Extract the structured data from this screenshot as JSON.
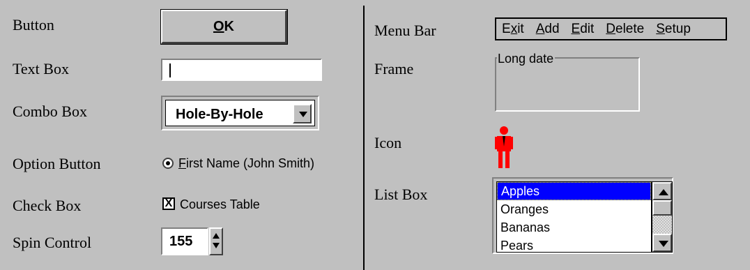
{
  "labels": {
    "button": "Button",
    "text_box": "Text Box",
    "combo_box": "Combo Box",
    "option_button": "Option Button",
    "check_box": "Check Box",
    "spin_control": "Spin Control",
    "menu_bar": "Menu Bar",
    "frame": "Frame",
    "icon": "Icon",
    "list_box": "List Box"
  },
  "ok_button": {
    "mnemonic": "O",
    "rest": "K"
  },
  "text_box": {
    "value": ""
  },
  "combo_box": {
    "value": "Hole-By-Hole"
  },
  "option_button": {
    "mnemonic": "F",
    "rest": "irst Name (John Smith)",
    "selected": true
  },
  "check_box": {
    "mark": "X",
    "label": "Courses Table",
    "checked": true
  },
  "spin_control": {
    "value": "155"
  },
  "menu_bar": {
    "items": [
      {
        "pre": "E",
        "u": "x",
        "post": "it"
      },
      {
        "pre": "",
        "u": "A",
        "post": "dd"
      },
      {
        "pre": "",
        "u": "E",
        "post": "dit"
      },
      {
        "pre": "",
        "u": "D",
        "post": "elete"
      },
      {
        "pre": "",
        "u": "S",
        "post": "etup"
      }
    ]
  },
  "frame": {
    "caption": "Long date"
  },
  "icon": {
    "name": "person-icon",
    "color": "#ff0000"
  },
  "list_box": {
    "items": [
      "Apples",
      "Oranges",
      "Bananas",
      "Pears"
    ],
    "selected_index": 0,
    "selection_color": "#0000ff"
  }
}
